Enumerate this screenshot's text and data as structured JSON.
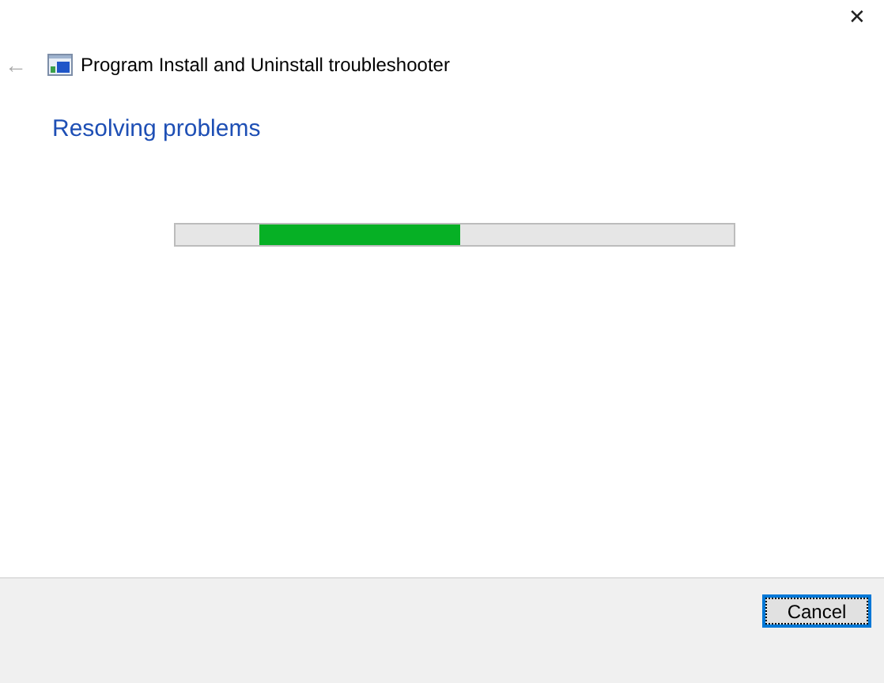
{
  "window": {
    "title": "Program Install and Uninstall troubleshooter",
    "close": "✕",
    "back": "←"
  },
  "heading": "Resolving problems",
  "progress": {
    "kind": "marquee",
    "level": 0.36
  },
  "buttons": [
    {
      "label": "Cancel",
      "focused": true
    }
  ]
}
